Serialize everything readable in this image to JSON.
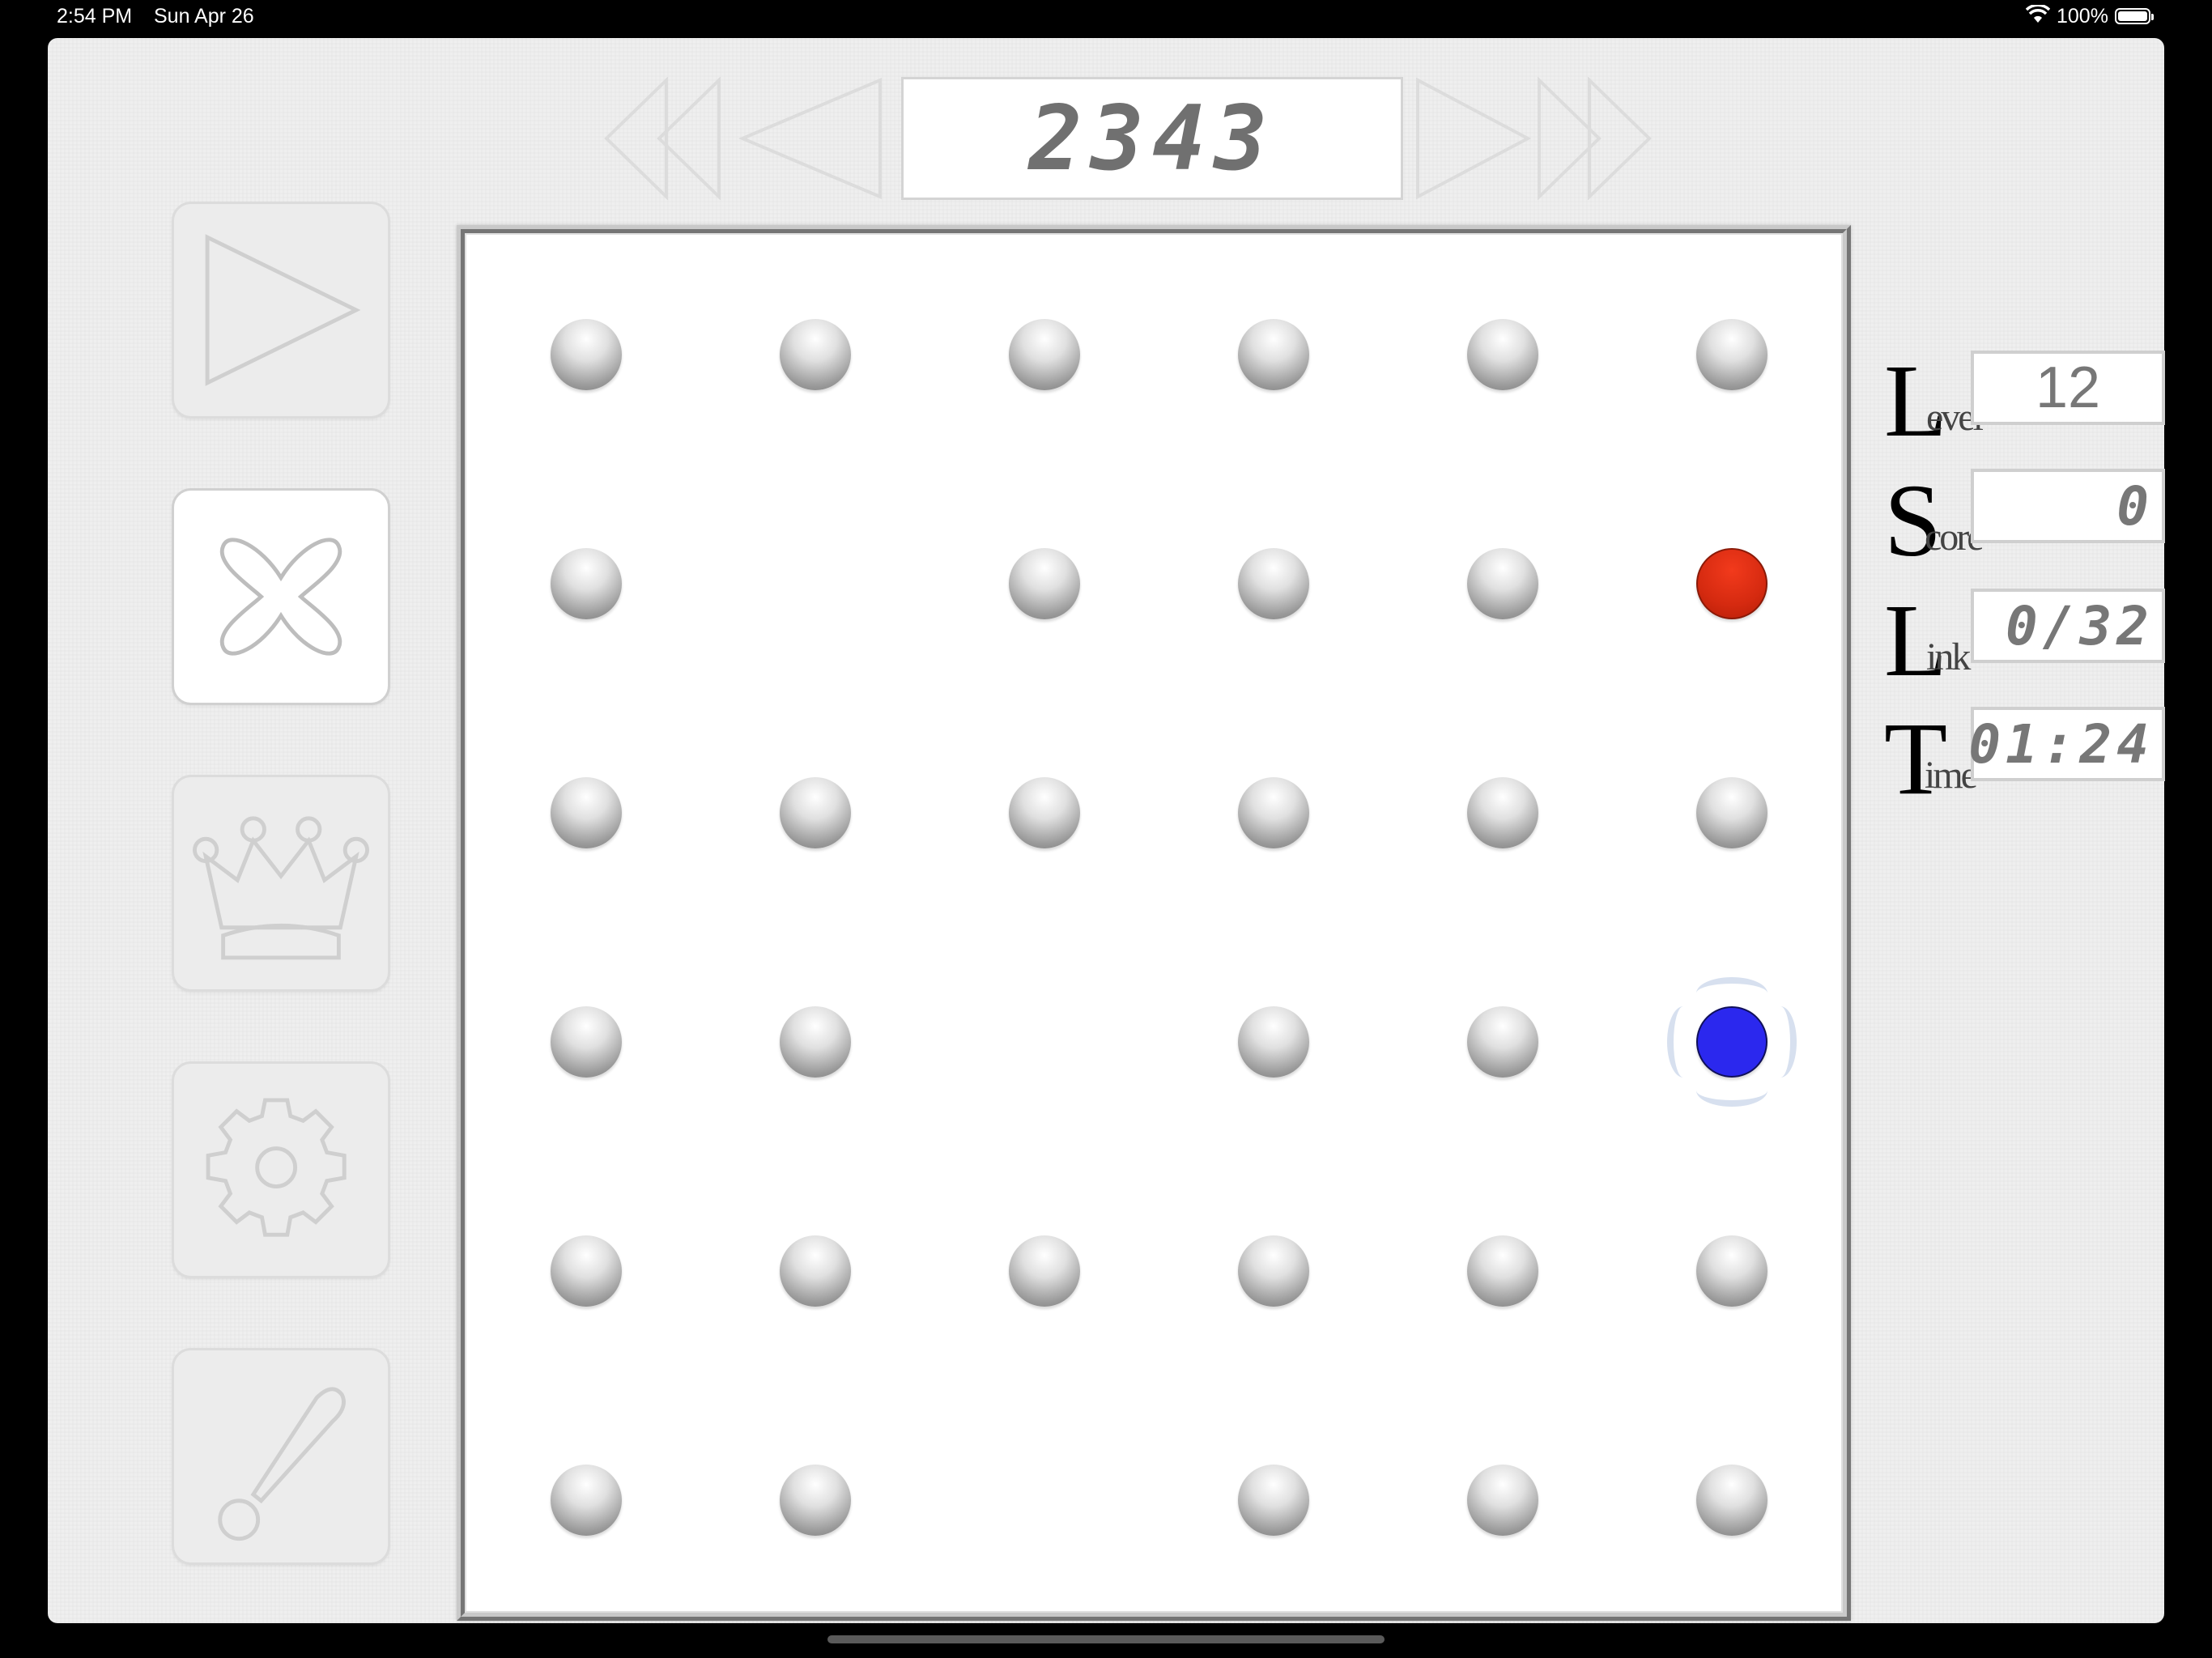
{
  "status_bar": {
    "time": "2:54 PM",
    "date": "Sun Apr 26",
    "battery": "100%"
  },
  "puzzle_number": "2343",
  "stats": {
    "level": {
      "initial": "L",
      "rest": "evel",
      "value": "12"
    },
    "score": {
      "initial": "S",
      "rest": "core",
      "value": "0"
    },
    "link": {
      "initial": "L",
      "rest": "ink",
      "value": "0/32"
    },
    "time": {
      "initial": "T",
      "rest": "ime",
      "value": "01:24"
    }
  },
  "board": {
    "rows": 6,
    "cols": 6,
    "cells": [
      [
        "peg",
        "peg",
        "peg",
        "peg",
        "peg",
        "peg"
      ],
      [
        "peg",
        "empty",
        "peg",
        "peg",
        "peg",
        "red"
      ],
      [
        "peg",
        "peg",
        "peg",
        "peg",
        "peg",
        "peg"
      ],
      [
        "peg",
        "peg",
        "empty",
        "peg",
        "peg",
        "blue"
      ],
      [
        "peg",
        "peg",
        "peg",
        "peg",
        "peg",
        "peg"
      ],
      [
        "peg",
        "peg",
        "empty",
        "peg",
        "peg",
        "peg"
      ]
    ],
    "selected": {
      "row": 4,
      "col": 6
    }
  },
  "tools": [
    "play-icon",
    "close-icon",
    "crown-icon",
    "gear-icon",
    "hint-icon"
  ],
  "colors": {
    "red_peg": "#d52a10",
    "blue_peg": "#2b28ee",
    "background": "#efefef"
  }
}
